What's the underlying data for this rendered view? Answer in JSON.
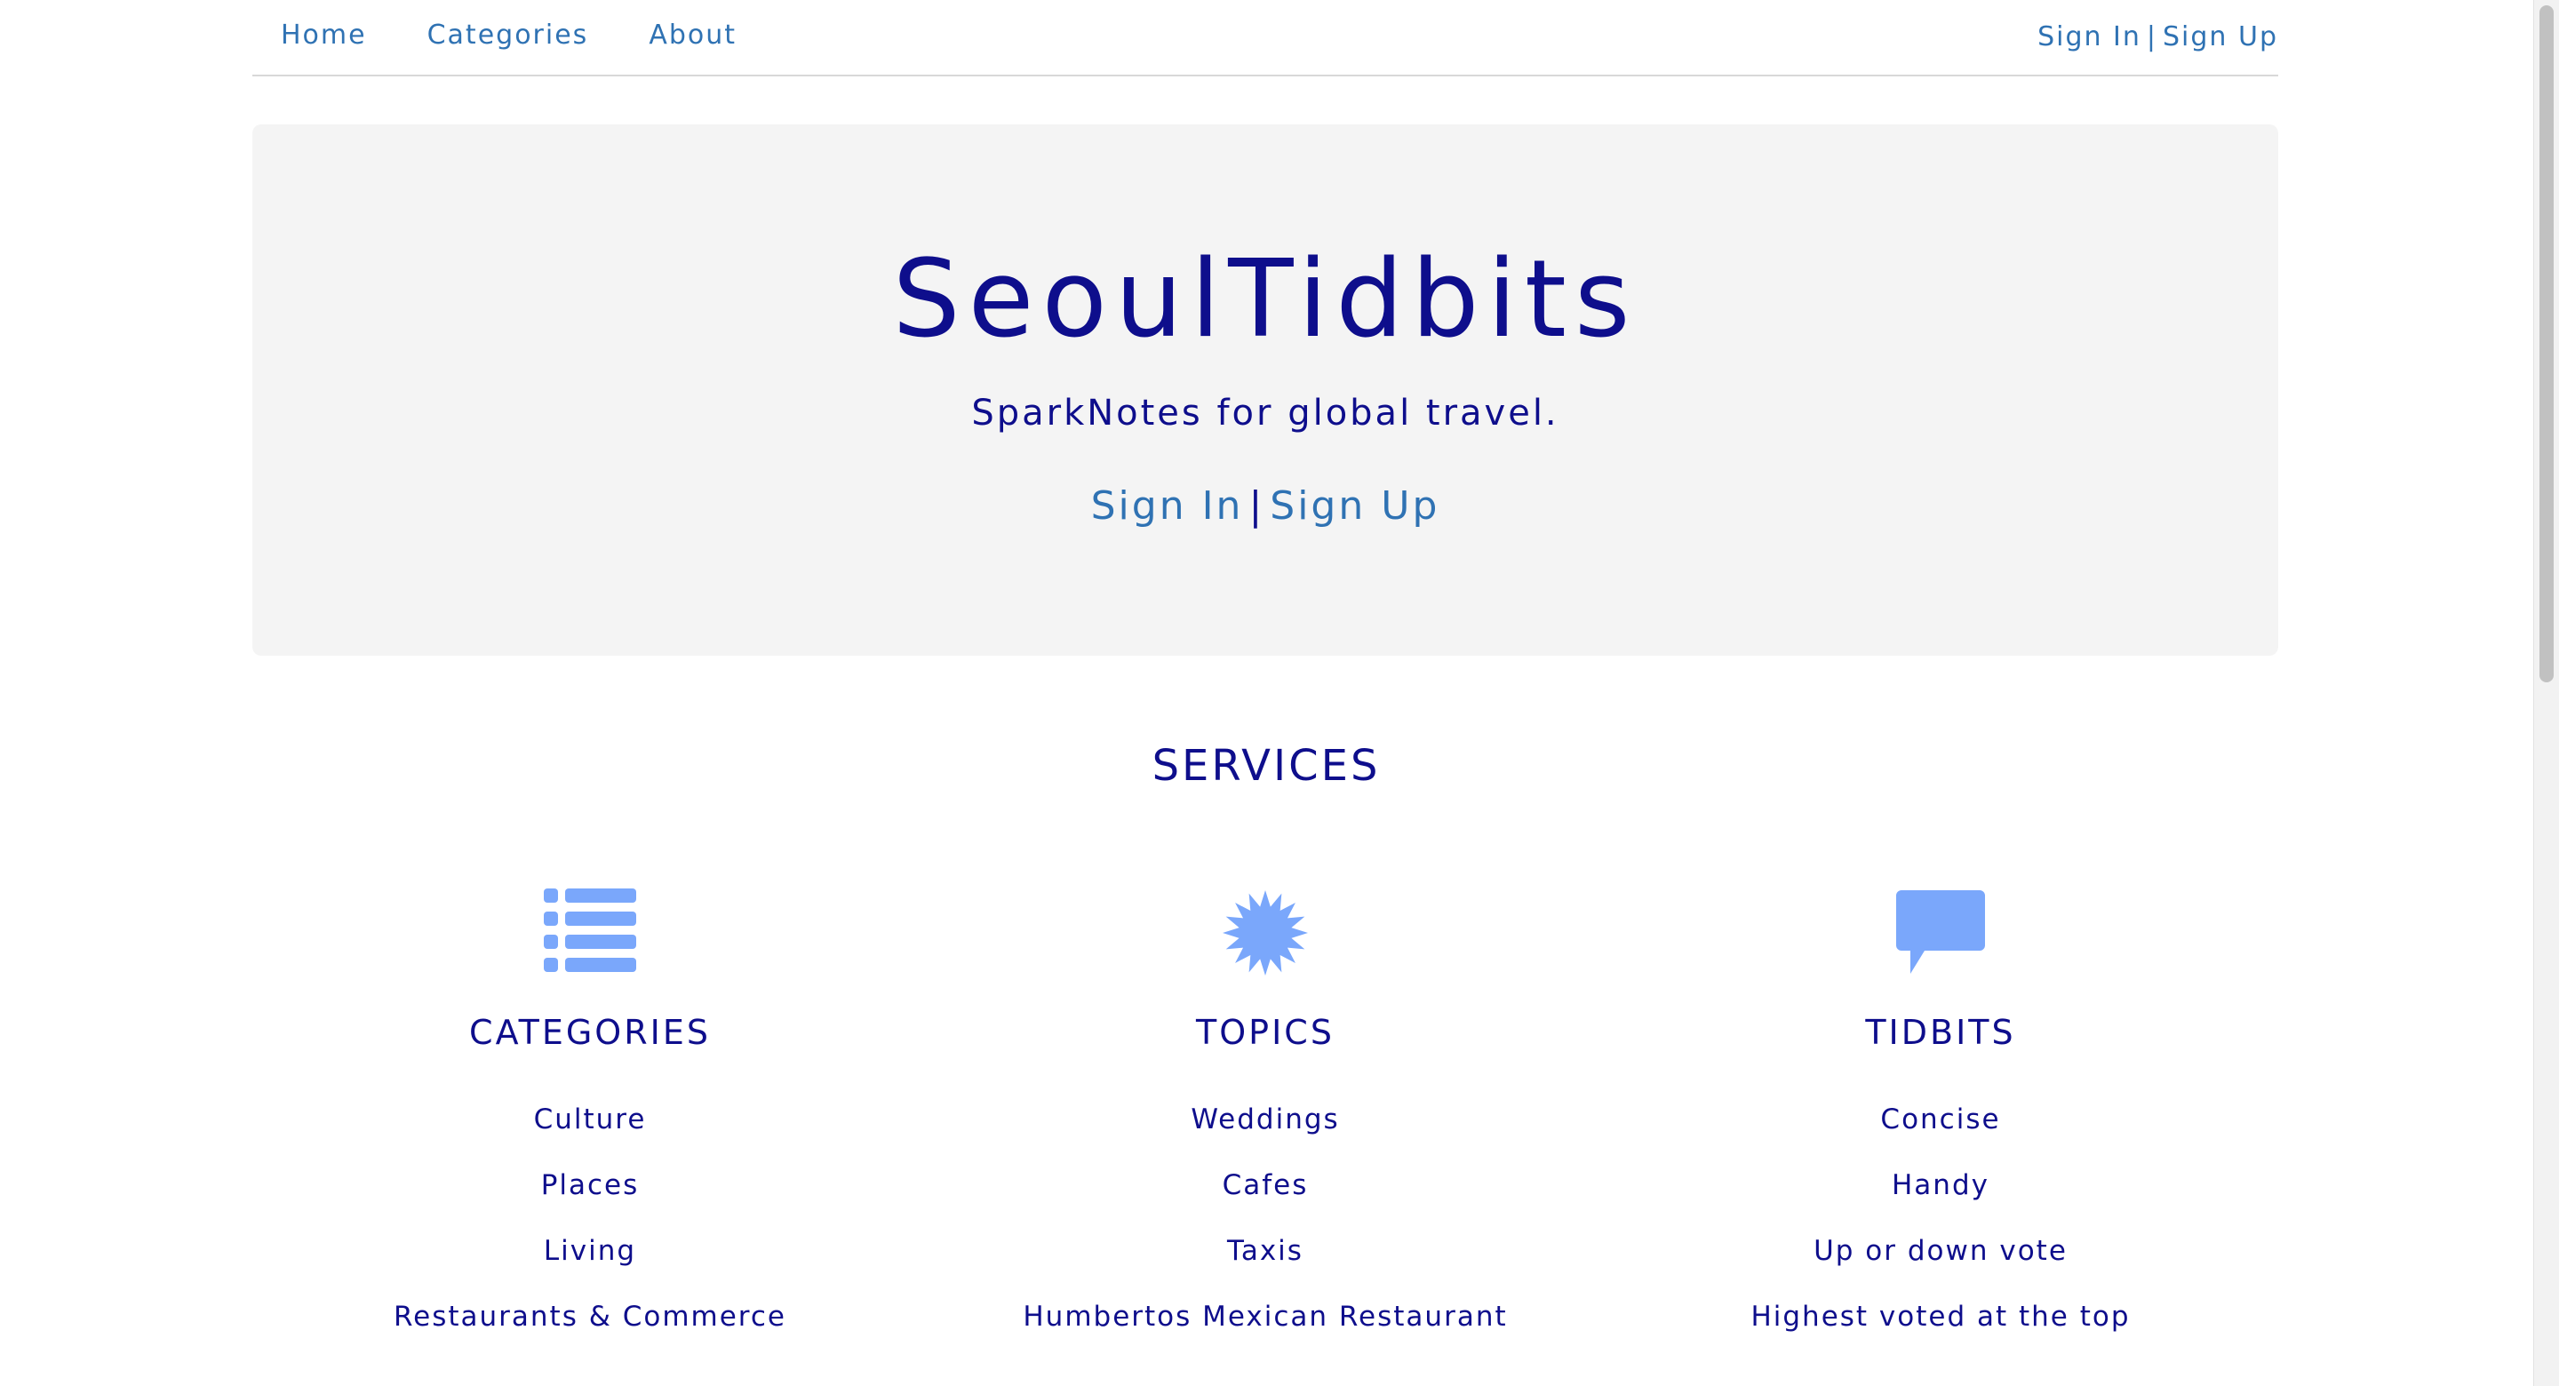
{
  "nav": {
    "items": [
      {
        "label": "Home"
      },
      {
        "label": "Categories"
      },
      {
        "label": "About"
      }
    ],
    "sign_in": "Sign In",
    "separator": "|",
    "sign_up": "Sign Up"
  },
  "hero": {
    "title": "SeoulTidbits",
    "tagline": "SparkNotes for global travel.",
    "sign_in": "Sign In",
    "separator": "|",
    "sign_up": "Sign Up"
  },
  "services": {
    "title": "SERVICES",
    "columns": [
      {
        "icon": "list-icon",
        "heading": "CATEGORIES",
        "items": [
          "Culture",
          "Places",
          "Living",
          "Restaurants & Commerce"
        ]
      },
      {
        "icon": "starburst-icon",
        "heading": "TOPICS",
        "items": [
          "Weddings",
          "Cafes",
          "Taxis",
          "Humbertos Mexican Restaurant"
        ]
      },
      {
        "icon": "speech-bubble-icon",
        "heading": "TIDBITS",
        "items": [
          "Concise",
          "Handy",
          "Up or down vote",
          "Highest voted at the top"
        ]
      }
    ]
  },
  "colors": {
    "primary_text": "#0e0e8c",
    "link": "#2f72b3",
    "icon": "#7aa7fb",
    "hero_background": "#f4f4f4"
  }
}
